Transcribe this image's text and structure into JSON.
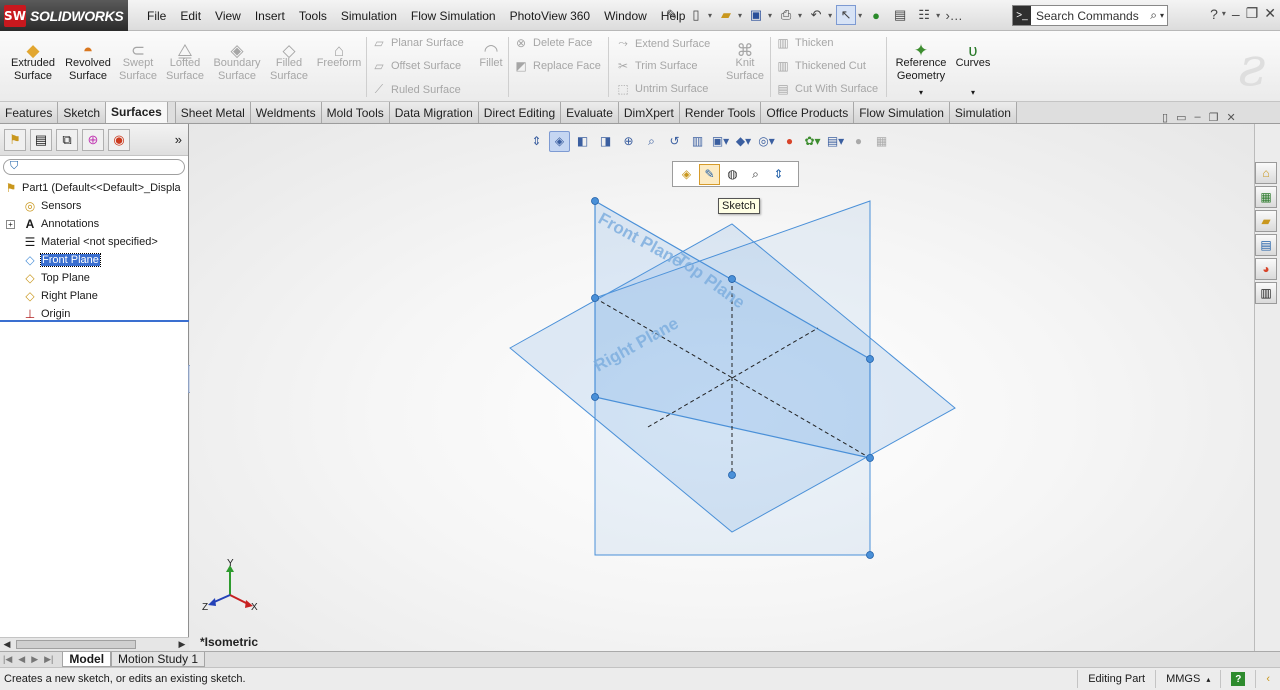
{
  "app": {
    "logo_mark": "SW",
    "name": "SOLIDWORKS"
  },
  "menu": [
    "File",
    "Edit",
    "View",
    "Insert",
    "Tools",
    "Simulation",
    "Flow Simulation",
    "PhotoView 360",
    "Window",
    "Help"
  ],
  "search": {
    "placeholder": "Search Commands"
  },
  "ribbon": {
    "big_buttons": [
      {
        "label": "Extruded Surface",
        "icon": "extruded-surface-icon",
        "enabled": true
      },
      {
        "label": "Revolved Surface",
        "icon": "revolved-surface-icon",
        "enabled": true
      },
      {
        "label": "Swept Surface",
        "icon": "swept-surface-icon",
        "enabled": false
      },
      {
        "label": "Lofted Surface",
        "icon": "lofted-surface-icon",
        "enabled": false
      },
      {
        "label": "Boundary Surface",
        "icon": "boundary-surface-icon",
        "enabled": false
      },
      {
        "label": "Filled Surface",
        "icon": "filled-surface-icon",
        "enabled": false
      },
      {
        "label": "Freeform",
        "icon": "freeform-icon",
        "enabled": false
      }
    ],
    "group1": [
      "Planar Surface",
      "Offset Surface",
      "Ruled Surface"
    ],
    "fillet": "Fillet",
    "group2": [
      "Delete Face",
      "Replace Face"
    ],
    "group3": [
      "Extend Surface",
      "Trim Surface",
      "Untrim Surface"
    ],
    "knit": "Knit Surface",
    "group4": [
      "Thicken",
      "Thickened Cut",
      "Cut With Surface"
    ],
    "reference_geometry": "Reference Geometry",
    "curves": "Curves"
  },
  "tabs": [
    "Features",
    "Sketch",
    "Surfaces",
    "Sheet Metal",
    "Weldments",
    "Mold Tools",
    "Data Migration",
    "Direct Editing",
    "Evaluate",
    "DimXpert",
    "Render Tools",
    "Office Products",
    "Flow Simulation",
    "Simulation"
  ],
  "active_tab": "Surfaces",
  "feature_tree": {
    "root": "Part1  (Default<<Default>_Displa",
    "items": [
      {
        "label": "Sensors",
        "icon": "sensors-icon"
      },
      {
        "label": "Annotations",
        "icon": "annotations-icon"
      },
      {
        "label": "Material <not specified>",
        "icon": "material-icon"
      },
      {
        "label": "Front Plane",
        "icon": "plane-icon",
        "selected": true
      },
      {
        "label": "Top Plane",
        "icon": "plane-icon"
      },
      {
        "label": "Right Plane",
        "icon": "plane-icon"
      },
      {
        "label": "Origin",
        "icon": "origin-icon"
      }
    ]
  },
  "viewport": {
    "plane_labels": {
      "front": "Front Plane",
      "top": "Top Plane",
      "right": "Right Plane"
    },
    "tooltip": "Sketch",
    "view_name": "*Isometric",
    "triad": {
      "x": "X",
      "y": "Y",
      "z": "Z"
    },
    "plane_color": "#4a90d8"
  },
  "bottom_tabs": [
    "Model",
    "Motion Study 1"
  ],
  "status": {
    "message": "Creates a new sketch, or edits an existing sketch.",
    "mode": "Editing Part",
    "units": "MMGS"
  }
}
